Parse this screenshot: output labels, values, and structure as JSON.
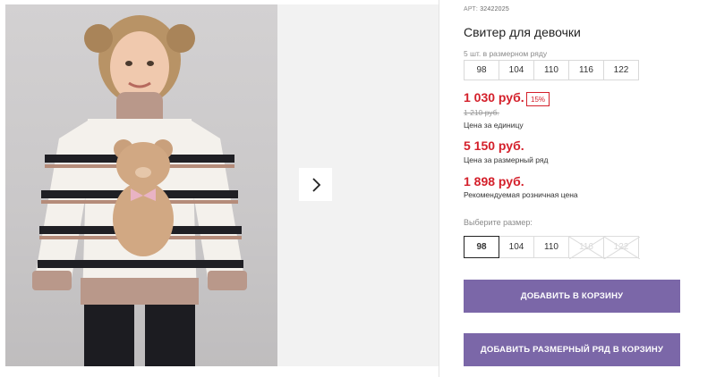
{
  "gallery": {
    "main_image_alt": "girl-in-bear-sweater-photo",
    "next_icon": "chevron-right-icon"
  },
  "product": {
    "article_prefix": "АРТ:",
    "article_number": "32422025",
    "title": "Свитер для девочки"
  },
  "size_pack": {
    "caption": "5 шт. в размерном ряду",
    "sizes": [
      "98",
      "104",
      "110",
      "116",
      "122"
    ]
  },
  "pricing": {
    "unit_price": "1 030 руб.",
    "discount": "15%",
    "old_price": "1 210 руб.",
    "unit_price_note": "Цена за единицу",
    "pack_price": "5 150 руб.",
    "pack_price_note": "Цена за размерный ряд",
    "retail_price": "1 898 руб.",
    "retail_price_note": "Рекомендуемая розничная цена"
  },
  "size_select": {
    "caption": "Выберите размер:",
    "options": [
      {
        "label": "98",
        "state": "selected"
      },
      {
        "label": "104",
        "state": "available"
      },
      {
        "label": "110",
        "state": "available"
      },
      {
        "label": "116",
        "state": "disabled"
      },
      {
        "label": "122",
        "state": "disabled"
      }
    ]
  },
  "actions": {
    "add_to_cart": "Добавить в корзину",
    "add_pack_to_cart": "Добавить размерный ряд в корзину"
  },
  "colors": {
    "price_red": "#d4202b",
    "button_purple": "#7b67a8"
  }
}
